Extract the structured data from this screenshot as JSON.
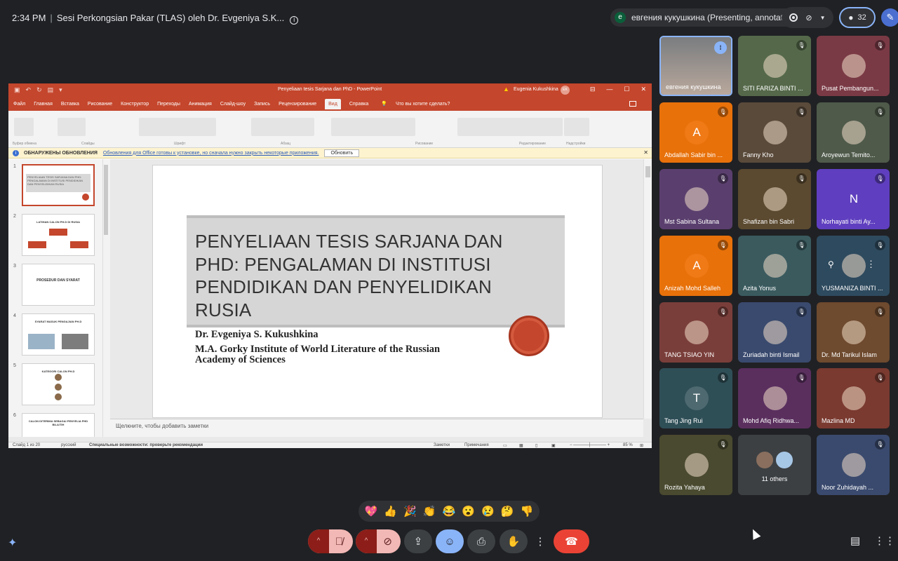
{
  "meeting": {
    "time": "2:34 PM",
    "title": "Sesi Perkongsian Pakar (TLAS) oleh Dr. Evgeniya S.K...",
    "presenter_initial": "е",
    "presenter_label": "евгения кукушкина (Presenting, annotating)",
    "participant_count": "32"
  },
  "ppt": {
    "doc_title": "Penyeliaan tesis Sarjana dan PhD  -  PowerPoint",
    "user": "Eugenia Kukushkina",
    "user_badge": "EK",
    "tabs": [
      "Файл",
      "Главная",
      "Вставка",
      "Рисование",
      "Конструктор",
      "Переходы",
      "Анимация",
      "Слайд-шоу",
      "Запись",
      "Рецензирование"
    ],
    "active_tab": "Вид",
    "tab_after": "Справка",
    "tell_me": "Что вы хотите сделать?",
    "ribbon_groups": [
      "Буфер обмена",
      "Слайды",
      "Шрифт",
      "Абзац",
      "Рисование",
      "Редактирование",
      "Надстройки"
    ],
    "notice_title": "ОБНАРУЖЕНЫ ОБНОВЛЕНИЯ",
    "notice_text": "Обновления для Office готовы к установке, но сначала нужно закрыть некоторые приложения.",
    "notice_button": "Обновить",
    "notes_placeholder": "Щелкните, чтобы добавить заметки",
    "status_slide": "Слайд 1 из 20",
    "status_lang": "русский",
    "status_access": "Специальные возможности: проверьте рекомендации",
    "status_notes": "Заметки",
    "status_comments": "Примечания",
    "zoom": "85 %",
    "thumbs": [
      {
        "num": "1",
        "text": "PENYELIAAN TESIS SARJANA DAN PHD: PENGALAMAN DI INSTITUSI PENDIDIKAN DAN PENYELIDIKAN RUSIA"
      },
      {
        "num": "2",
        "text": "LATIHAN CALON PH.D DI RUSIA"
      },
      {
        "num": "3",
        "text": "PROSEDUR DAN SYARAT"
      },
      {
        "num": "4",
        "text": "SYARAT MASUK PENGAJIAN PH.D"
      },
      {
        "num": "5",
        "text": "KATEGORI CALON PH.D"
      },
      {
        "num": "6",
        "text": "CALON DITERIMA SEBAGAI PENYELIA PHD BILA/TIH"
      }
    ]
  },
  "slide": {
    "title": "PENYELIAAN TESIS SARJANA DAN PHD: PENGALAMAN DI INSTITUSI PENDIDIKAN DAN PENYELIDIKAN RUSIA",
    "author": "Dr. Evgeniya S. Kukushkina",
    "affiliation": "M.A. Gorky Institute of World Literature of the Russian Academy of Sciences",
    "seal_color": "#c4462c"
  },
  "participants": [
    {
      "name": "евгения кукушкина",
      "status": "speaking",
      "initial": "",
      "color": "#6b6f74"
    },
    {
      "name": "SITI FARIZA BINTI ...",
      "status": "muted",
      "initial": "",
      "color": "#55694a"
    },
    {
      "name": "Pusat Pembangun...",
      "status": "muted",
      "initial": "",
      "color": "#7a3a45"
    },
    {
      "name": "Abdallah Sabir bin ...",
      "status": "muted",
      "initial": "A",
      "color": "#e8710a"
    },
    {
      "name": "Fanny Kho",
      "status": "muted",
      "initial": "",
      "color": "#5a4a3a"
    },
    {
      "name": "Aroyewun Temito...",
      "status": "muted",
      "initial": "",
      "color": "#4f5a4a"
    },
    {
      "name": "Mst Sabina Sultana",
      "status": "muted",
      "initial": "",
      "color": "#5a3f6e"
    },
    {
      "name": "Shafizan bin Sabri",
      "status": "muted",
      "initial": "",
      "color": "#5b4a30"
    },
    {
      "name": "Norhayati binti Ay...",
      "status": "muted",
      "initial": "N",
      "color": "#5f3fbf"
    },
    {
      "name": "Anizah Mohd Salleh",
      "status": "muted",
      "initial": "A",
      "color": "#e8710a"
    },
    {
      "name": "Azita Yonus",
      "status": "muted",
      "initial": "",
      "color": "#3a5a5e"
    },
    {
      "name": "YUSMANIZA BINTI ...",
      "status": "muted",
      "initial": "",
      "color": "#2e4a5e"
    },
    {
      "name": "TANG TSIAO YIN",
      "status": "muted",
      "initial": "",
      "color": "#7a3e3a"
    },
    {
      "name": "Zuriadah binti Ismail",
      "status": "muted",
      "initial": "",
      "color": "#3a4a6e"
    },
    {
      "name": "Dr. Md Tarikul Islam",
      "status": "muted",
      "initial": "",
      "color": "#6e4a2e"
    },
    {
      "name": "Tang Jing Rui",
      "status": "muted",
      "initial": "T",
      "color": "#2f4f57"
    },
    {
      "name": "Mohd Afiq Ridhwa...",
      "status": "muted",
      "initial": "",
      "color": "#5a2f5e"
    },
    {
      "name": "Mazlina MD",
      "status": "muted",
      "initial": "",
      "color": "#7a3a30"
    },
    {
      "name": "Rozita Yahaya",
      "status": "muted",
      "initial": "",
      "color": "#4a4a30"
    },
    {
      "name": "11 others",
      "status": "",
      "initial": "",
      "color": "#3c4043"
    },
    {
      "name": "Noor Zuhidayah ...",
      "status": "muted",
      "initial": "",
      "color": "#3a4a6e"
    }
  ],
  "reactions": [
    "💖",
    "👍",
    "🎉",
    "👏",
    "😂",
    "😮",
    "😢",
    "🤔",
    "👎"
  ],
  "controls": {
    "mic": "mic-off",
    "camera": "camera-off",
    "present": "present-screen",
    "emoji": "emoji",
    "captions": "captions",
    "hand": "raise-hand",
    "more": "more-options",
    "leave": "leave-call",
    "leave_color": "#ea4335"
  }
}
